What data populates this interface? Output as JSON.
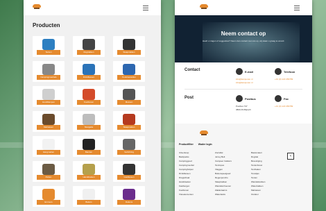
{
  "left": {
    "title": "Producten",
    "tiles": [
      {
        "label": "Tenten",
        "color": "#2d7fc1"
      },
      {
        "label": "Rugzakken",
        "color": "#444"
      },
      {
        "label": "Slaapzakken",
        "color": "#333"
      },
      {
        "label": "Campingmeubels",
        "color": "#888"
      },
      {
        "label": "Drinkflessen",
        "color": "#2b73b8"
      },
      {
        "label": "Kooktoestellen",
        "color": "#2d67b0"
      },
      {
        "label": "Hoofdlampen",
        "color": "#cfcfcf"
      },
      {
        "label": "Koelboxen",
        "color": "#d44b2a"
      },
      {
        "label": "Messen",
        "color": "#555"
      },
      {
        "label": "Matrassen",
        "color": "#6b4b2c"
      },
      {
        "label": "Navigatie",
        "color": "#bdbdbd"
      },
      {
        "label": "Slaapmatten",
        "color": "#b53a1f"
      },
      {
        "label": "Hangmatten",
        "color": "#f2f2f2"
      },
      {
        "label": "Banden",
        "color": "#222"
      },
      {
        "label": "Verlichting",
        "color": "#666"
      },
      {
        "label": "Petten",
        "color": "#6b5b44"
      },
      {
        "label": "Handdoeken",
        "color": "#b5a04c"
      },
      {
        "label": "Gasflessen",
        "color": "#333"
      },
      {
        "label": "Emmers",
        "color": "#e58a2e"
      },
      {
        "label": "Bekers",
        "color": "#f0f0f0"
      },
      {
        "label": "Dekens",
        "color": "#6b2d8c"
      }
    ]
  },
  "right": {
    "hero": {
      "title": "Neem contact op",
      "subtitle": "Heeft u vragen of suggesties? Neem dan contact met ons op, wij staan u graag te woord."
    },
    "contact": {
      "heading": "Contact",
      "email_label": "E-mail",
      "email_lines": [
        "info@kamperen.nl",
        "info@kamperen.nl"
      ],
      "phone_label": "Telefoon",
      "phone_lines": [
        "+31 (0) 123 456789"
      ]
    },
    "post": {
      "heading": "Post",
      "postbus_label": "Postbus",
      "postbus_lines": [
        "Postbus 737",
        "3800 AS Bijnsch"
      ],
      "fax_label": "Fax",
      "fax_lines": [
        "+31 (0) 123 456789"
      ]
    },
    "footer": {
      "tab1": "Productfilter",
      "tab2": "Wader login",
      "btn": "‹",
      "col1": [
        "Uitverkoop",
        "Backpacks",
        "Campinggoed",
        "Campingmeubel",
        "Campinghulpen",
        "Drinkflessen",
        "Dragschaal",
        "Handdoeken",
        "Kastbergen",
        "Koelboxen",
        "Vrieselementen"
      ],
      "col2": [
        "Zonluifel",
        "Jerrey Belt",
        "Campeer trekkers",
        "Tentropes",
        "Vlaggen",
        "Buitenspeelgoed",
        "Regenponcho",
        "Slaapzakken",
        "Wandelschoenen",
        "Zaklantaarns",
        "Watertanks"
      ],
      "col3": [
        "Basismateri",
        "Rugzak",
        "Bevestiging",
        "Tentenbouw",
        "Tenthaken",
        "Touwtjes",
        "Tenten",
        "Wandelstokken",
        "Waterzakken",
        "Matrassen",
        "Outdoor"
      ]
    }
  }
}
